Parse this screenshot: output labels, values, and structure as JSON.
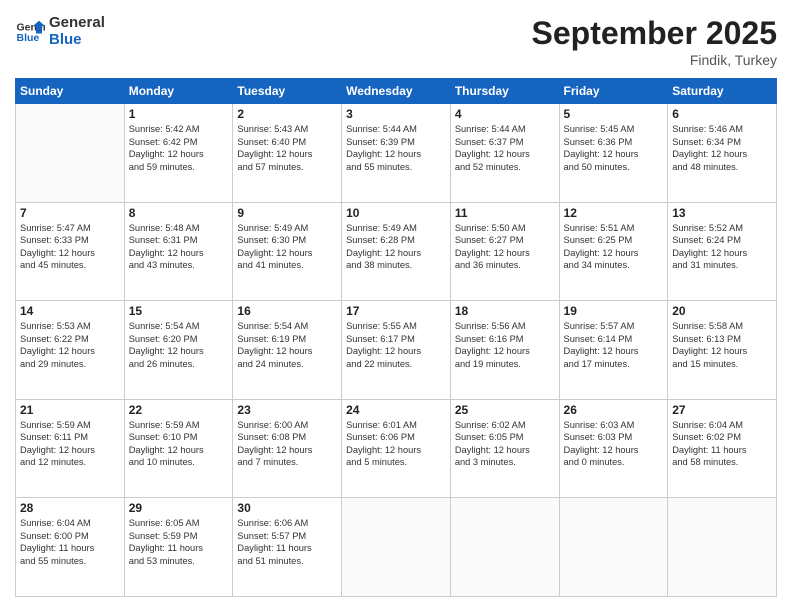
{
  "logo": {
    "line1": "General",
    "line2": "Blue"
  },
  "title": "September 2025",
  "location": "Findik, Turkey",
  "days_of_week": [
    "Sunday",
    "Monday",
    "Tuesday",
    "Wednesday",
    "Thursday",
    "Friday",
    "Saturday"
  ],
  "weeks": [
    [
      {
        "day": "",
        "data": ""
      },
      {
        "day": "1",
        "data": "Sunrise: 5:42 AM\nSunset: 6:42 PM\nDaylight: 12 hours\nand 59 minutes."
      },
      {
        "day": "2",
        "data": "Sunrise: 5:43 AM\nSunset: 6:40 PM\nDaylight: 12 hours\nand 57 minutes."
      },
      {
        "day": "3",
        "data": "Sunrise: 5:44 AM\nSunset: 6:39 PM\nDaylight: 12 hours\nand 55 minutes."
      },
      {
        "day": "4",
        "data": "Sunrise: 5:44 AM\nSunset: 6:37 PM\nDaylight: 12 hours\nand 52 minutes."
      },
      {
        "day": "5",
        "data": "Sunrise: 5:45 AM\nSunset: 6:36 PM\nDaylight: 12 hours\nand 50 minutes."
      },
      {
        "day": "6",
        "data": "Sunrise: 5:46 AM\nSunset: 6:34 PM\nDaylight: 12 hours\nand 48 minutes."
      }
    ],
    [
      {
        "day": "7",
        "data": "Sunrise: 5:47 AM\nSunset: 6:33 PM\nDaylight: 12 hours\nand 45 minutes."
      },
      {
        "day": "8",
        "data": "Sunrise: 5:48 AM\nSunset: 6:31 PM\nDaylight: 12 hours\nand 43 minutes."
      },
      {
        "day": "9",
        "data": "Sunrise: 5:49 AM\nSunset: 6:30 PM\nDaylight: 12 hours\nand 41 minutes."
      },
      {
        "day": "10",
        "data": "Sunrise: 5:49 AM\nSunset: 6:28 PM\nDaylight: 12 hours\nand 38 minutes."
      },
      {
        "day": "11",
        "data": "Sunrise: 5:50 AM\nSunset: 6:27 PM\nDaylight: 12 hours\nand 36 minutes."
      },
      {
        "day": "12",
        "data": "Sunrise: 5:51 AM\nSunset: 6:25 PM\nDaylight: 12 hours\nand 34 minutes."
      },
      {
        "day": "13",
        "data": "Sunrise: 5:52 AM\nSunset: 6:24 PM\nDaylight: 12 hours\nand 31 minutes."
      }
    ],
    [
      {
        "day": "14",
        "data": "Sunrise: 5:53 AM\nSunset: 6:22 PM\nDaylight: 12 hours\nand 29 minutes."
      },
      {
        "day": "15",
        "data": "Sunrise: 5:54 AM\nSunset: 6:20 PM\nDaylight: 12 hours\nand 26 minutes."
      },
      {
        "day": "16",
        "data": "Sunrise: 5:54 AM\nSunset: 6:19 PM\nDaylight: 12 hours\nand 24 minutes."
      },
      {
        "day": "17",
        "data": "Sunrise: 5:55 AM\nSunset: 6:17 PM\nDaylight: 12 hours\nand 22 minutes."
      },
      {
        "day": "18",
        "data": "Sunrise: 5:56 AM\nSunset: 6:16 PM\nDaylight: 12 hours\nand 19 minutes."
      },
      {
        "day": "19",
        "data": "Sunrise: 5:57 AM\nSunset: 6:14 PM\nDaylight: 12 hours\nand 17 minutes."
      },
      {
        "day": "20",
        "data": "Sunrise: 5:58 AM\nSunset: 6:13 PM\nDaylight: 12 hours\nand 15 minutes."
      }
    ],
    [
      {
        "day": "21",
        "data": "Sunrise: 5:59 AM\nSunset: 6:11 PM\nDaylight: 12 hours\nand 12 minutes."
      },
      {
        "day": "22",
        "data": "Sunrise: 5:59 AM\nSunset: 6:10 PM\nDaylight: 12 hours\nand 10 minutes."
      },
      {
        "day": "23",
        "data": "Sunrise: 6:00 AM\nSunset: 6:08 PM\nDaylight: 12 hours\nand 7 minutes."
      },
      {
        "day": "24",
        "data": "Sunrise: 6:01 AM\nSunset: 6:06 PM\nDaylight: 12 hours\nand 5 minutes."
      },
      {
        "day": "25",
        "data": "Sunrise: 6:02 AM\nSunset: 6:05 PM\nDaylight: 12 hours\nand 3 minutes."
      },
      {
        "day": "26",
        "data": "Sunrise: 6:03 AM\nSunset: 6:03 PM\nDaylight: 12 hours\nand 0 minutes."
      },
      {
        "day": "27",
        "data": "Sunrise: 6:04 AM\nSunset: 6:02 PM\nDaylight: 11 hours\nand 58 minutes."
      }
    ],
    [
      {
        "day": "28",
        "data": "Sunrise: 6:04 AM\nSunset: 6:00 PM\nDaylight: 11 hours\nand 55 minutes."
      },
      {
        "day": "29",
        "data": "Sunrise: 6:05 AM\nSunset: 5:59 PM\nDaylight: 11 hours\nand 53 minutes."
      },
      {
        "day": "30",
        "data": "Sunrise: 6:06 AM\nSunset: 5:57 PM\nDaylight: 11 hours\nand 51 minutes."
      },
      {
        "day": "",
        "data": ""
      },
      {
        "day": "",
        "data": ""
      },
      {
        "day": "",
        "data": ""
      },
      {
        "day": "",
        "data": ""
      }
    ]
  ]
}
